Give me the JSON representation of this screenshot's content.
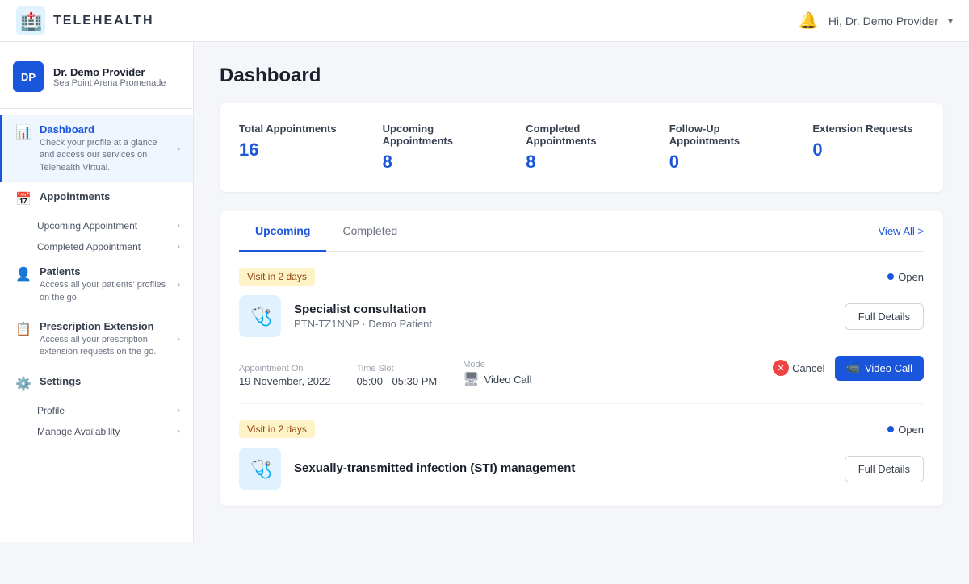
{
  "header": {
    "logo_text": "TELEHEALTH",
    "greeting": "Hi, Dr. Demo Provider",
    "chevron": "›"
  },
  "sidebar": {
    "user": {
      "initials": "DP",
      "name": "Dr. Demo Provider",
      "location": "Sea Point Arena Promenade"
    },
    "nav_items": [
      {
        "id": "dashboard",
        "icon": "📊",
        "title": "Dashboard",
        "desc": "Check your profile at a glance and access our services on Telehealth Virtual.",
        "active": true,
        "sub_items": []
      },
      {
        "id": "appointments",
        "icon": "📅",
        "title": "Appointments",
        "desc": "",
        "active": false,
        "sub_items": [
          "Upcoming Appointment",
          "Completed Appointment"
        ]
      },
      {
        "id": "patients",
        "icon": "👤",
        "title": "Patients",
        "desc": "Access all your patients' profiles on the go.",
        "active": false,
        "sub_items": []
      },
      {
        "id": "prescription",
        "icon": "📋",
        "title": "Prescription Extension",
        "desc": "Access all your prescription extension requests on the go.",
        "active": false,
        "sub_items": []
      },
      {
        "id": "settings",
        "icon": "⚙️",
        "title": "Settings",
        "desc": "",
        "active": false,
        "sub_items": [
          "Profile",
          "Manage Availability"
        ]
      }
    ]
  },
  "main": {
    "page_title": "Dashboard",
    "stats": {
      "items": [
        {
          "label": "Total Appointments",
          "value": "16"
        },
        {
          "label": "Upcoming Appointments",
          "value": "8"
        },
        {
          "label": "Completed Appointments",
          "value": "8"
        },
        {
          "label": "Follow-Up Appointments",
          "value": "0"
        },
        {
          "label": "Extension Requests",
          "value": "0"
        }
      ]
    },
    "tabs": {
      "items": [
        "Upcoming",
        "Completed"
      ],
      "active": "Upcoming"
    },
    "view_all": "View All >",
    "appointments": [
      {
        "badge": "Visit in 2 days",
        "status": "Open",
        "title": "Specialist consultation",
        "patient": "PTN-TZ1NNP · Demo Patient",
        "icon": "🩺",
        "appointment_on_label": "Appointment On",
        "appointment_on": "19 November, 2022",
        "time_slot_label": "Time Slot",
        "time_slot": "05:00 - 05:30 PM",
        "mode_label": "Mode",
        "mode": "Video Call",
        "cancel_label": "Cancel",
        "video_call_label": "Video Call",
        "full_details_label": "Full Details"
      },
      {
        "badge": "Visit in 2 days",
        "status": "Open",
        "title": "Sexually-transmitted infection (STI) management",
        "patient": "",
        "icon": "🩺",
        "appointment_on_label": "",
        "appointment_on": "",
        "time_slot_label": "",
        "time_slot": "",
        "mode_label": "",
        "mode": "",
        "cancel_label": "",
        "video_call_label": "",
        "full_details_label": "Full Details"
      }
    ]
  }
}
